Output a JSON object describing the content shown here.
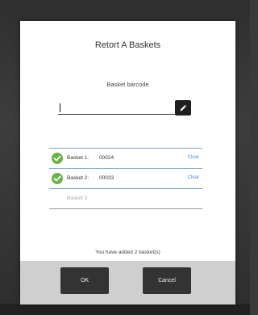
{
  "dialog": {
    "title": "Retort A Baskets",
    "barcode_label": "Basket barcode",
    "barcode_value": "",
    "barcode_placeholder": "",
    "edit_icon": "pencil-icon",
    "baskets": [
      {
        "label": "Basket 1:",
        "code": "00024",
        "action": "Clear",
        "icon": "check-circle-icon"
      },
      {
        "label": "Basket 2:",
        "code": "00033",
        "action": "Clear",
        "icon": "check-circle-icon"
      }
    ],
    "empty_slot_placeholder": "Basket 3",
    "status": "You have added 2 basket(s)",
    "ok_label": "OK",
    "cancel_label": "Cancel"
  },
  "colors": {
    "check": "#6ab445",
    "link": "#4a90d9",
    "button": "#333333",
    "footer": "#cfcfcf"
  }
}
